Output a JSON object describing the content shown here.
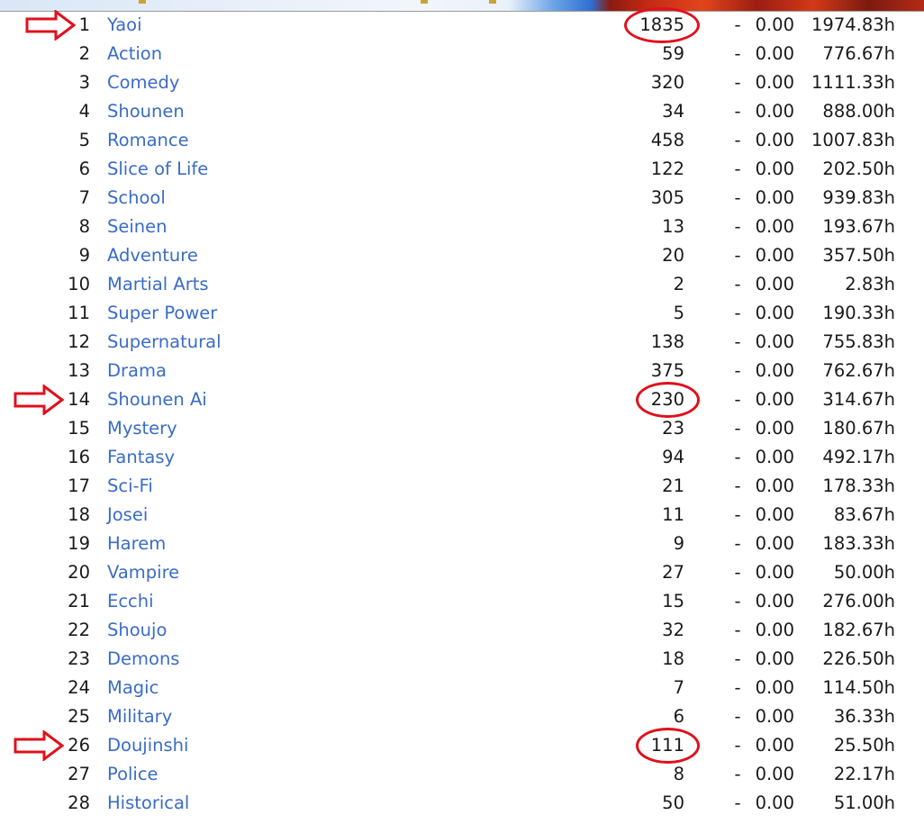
{
  "annotation_color": "#e0101c",
  "link_color": "#3a6cc7",
  "highlighted_rows": [
    "1",
    "14",
    "26"
  ],
  "rows": [
    {
      "rank": "1",
      "genre": "Yaoi",
      "count": "1835",
      "dash": "-",
      "score": "0.00",
      "hours": "1974.83h"
    },
    {
      "rank": "2",
      "genre": "Action",
      "count": "59",
      "dash": "-",
      "score": "0.00",
      "hours": "776.67h"
    },
    {
      "rank": "3",
      "genre": "Comedy",
      "count": "320",
      "dash": "-",
      "score": "0.00",
      "hours": "1111.33h"
    },
    {
      "rank": "4",
      "genre": "Shounen",
      "count": "34",
      "dash": "-",
      "score": "0.00",
      "hours": "888.00h"
    },
    {
      "rank": "5",
      "genre": "Romance",
      "count": "458",
      "dash": "-",
      "score": "0.00",
      "hours": "1007.83h"
    },
    {
      "rank": "6",
      "genre": "Slice of Life",
      "count": "122",
      "dash": "-",
      "score": "0.00",
      "hours": "202.50h"
    },
    {
      "rank": "7",
      "genre": "School",
      "count": "305",
      "dash": "-",
      "score": "0.00",
      "hours": "939.83h"
    },
    {
      "rank": "8",
      "genre": "Seinen",
      "count": "13",
      "dash": "-",
      "score": "0.00",
      "hours": "193.67h"
    },
    {
      "rank": "9",
      "genre": "Adventure",
      "count": "20",
      "dash": "-",
      "score": "0.00",
      "hours": "357.50h"
    },
    {
      "rank": "10",
      "genre": "Martial Arts",
      "count": "2",
      "dash": "-",
      "score": "0.00",
      "hours": "2.83h"
    },
    {
      "rank": "11",
      "genre": "Super Power",
      "count": "5",
      "dash": "-",
      "score": "0.00",
      "hours": "190.33h"
    },
    {
      "rank": "12",
      "genre": "Supernatural",
      "count": "138",
      "dash": "-",
      "score": "0.00",
      "hours": "755.83h"
    },
    {
      "rank": "13",
      "genre": "Drama",
      "count": "375",
      "dash": "-",
      "score": "0.00",
      "hours": "762.67h"
    },
    {
      "rank": "14",
      "genre": "Shounen Ai",
      "count": "230",
      "dash": "-",
      "score": "0.00",
      "hours": "314.67h"
    },
    {
      "rank": "15",
      "genre": "Mystery",
      "count": "23",
      "dash": "-",
      "score": "0.00",
      "hours": "180.67h"
    },
    {
      "rank": "16",
      "genre": "Fantasy",
      "count": "94",
      "dash": "-",
      "score": "0.00",
      "hours": "492.17h"
    },
    {
      "rank": "17",
      "genre": "Sci-Fi",
      "count": "21",
      "dash": "-",
      "score": "0.00",
      "hours": "178.33h"
    },
    {
      "rank": "18",
      "genre": "Josei",
      "count": "11",
      "dash": "-",
      "score": "0.00",
      "hours": "83.67h"
    },
    {
      "rank": "19",
      "genre": "Harem",
      "count": "9",
      "dash": "-",
      "score": "0.00",
      "hours": "183.33h"
    },
    {
      "rank": "20",
      "genre": "Vampire",
      "count": "27",
      "dash": "-",
      "score": "0.00",
      "hours": "50.00h"
    },
    {
      "rank": "21",
      "genre": "Ecchi",
      "count": "15",
      "dash": "-",
      "score": "0.00",
      "hours": "276.00h"
    },
    {
      "rank": "22",
      "genre": "Shoujo",
      "count": "32",
      "dash": "-",
      "score": "0.00",
      "hours": "182.67h"
    },
    {
      "rank": "23",
      "genre": "Demons",
      "count": "18",
      "dash": "-",
      "score": "0.00",
      "hours": "226.50h"
    },
    {
      "rank": "24",
      "genre": "Magic",
      "count": "7",
      "dash": "-",
      "score": "0.00",
      "hours": "114.50h"
    },
    {
      "rank": "25",
      "genre": "Military",
      "count": "6",
      "dash": "-",
      "score": "0.00",
      "hours": "36.33h"
    },
    {
      "rank": "26",
      "genre": "Doujinshi",
      "count": "111",
      "dash": "-",
      "score": "0.00",
      "hours": "25.50h"
    },
    {
      "rank": "27",
      "genre": "Police",
      "count": "8",
      "dash": "-",
      "score": "0.00",
      "hours": "22.17h"
    },
    {
      "rank": "28",
      "genre": "Historical",
      "count": "50",
      "dash": "-",
      "score": "0.00",
      "hours": "51.00h"
    }
  ]
}
